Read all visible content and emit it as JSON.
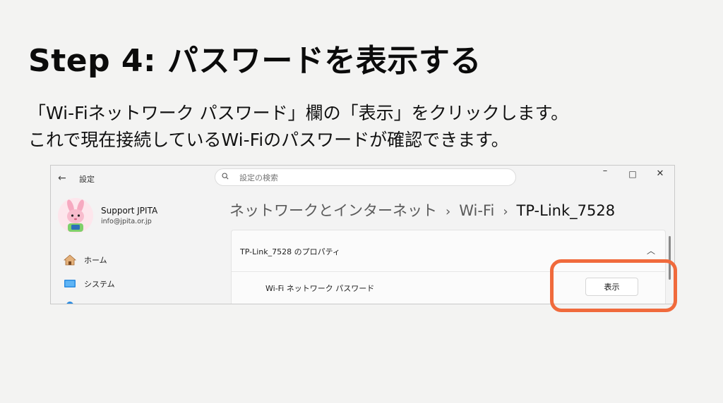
{
  "slide": {
    "title": "Step 4: パスワードを表示する",
    "line1": "「Wi-Fiネットワーク パスワード」欄の「表示」をクリックします。",
    "line2": "これで現在接続しているWi-Fiのパスワードが確認できます。"
  },
  "window": {
    "title": "設定",
    "search_placeholder": "設定の検索",
    "controls": {
      "minimize": "–",
      "maximize": "□",
      "close": "✕"
    }
  },
  "user": {
    "name": "Support JPITA",
    "email": "info@jpita.or.jp"
  },
  "sidebar": {
    "items": [
      {
        "label": "ホーム",
        "icon": "home-icon"
      },
      {
        "label": "システム",
        "icon": "system-icon"
      }
    ]
  },
  "breadcrumb": {
    "items": [
      "ネットワークとインターネット",
      "Wi-Fi",
      "TP-Link_7528"
    ],
    "separator": "›"
  },
  "card": {
    "title": "TP-Link_7528 のプロパティ",
    "password_label": "Wi-Fi ネットワーク パスワード",
    "show_button": "表示"
  },
  "colors": {
    "highlight": "#f06a3c",
    "background": "#f3f3f2"
  }
}
